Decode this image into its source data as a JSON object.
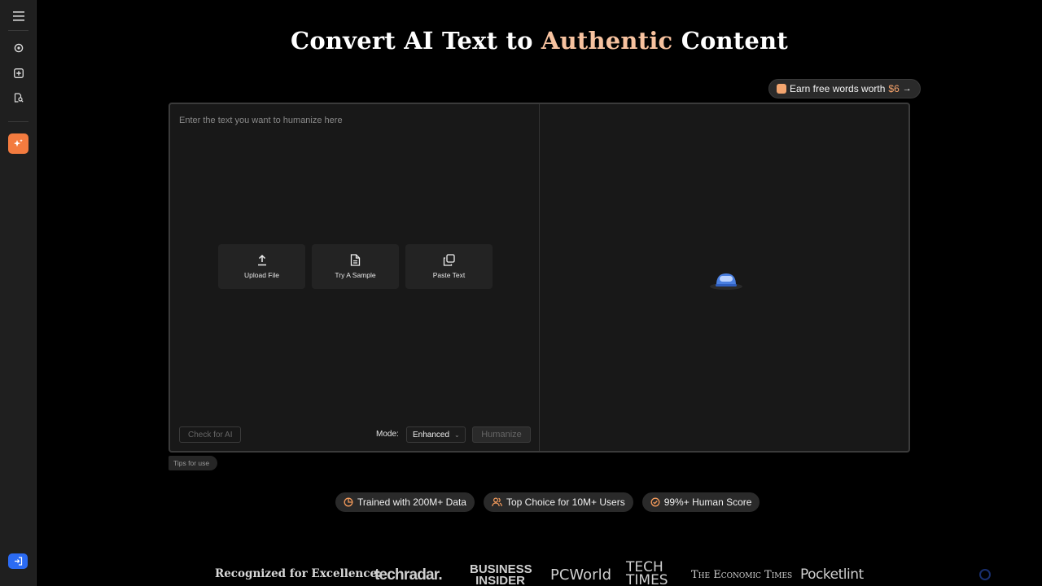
{
  "title": {
    "part1": "Convert AI Text to",
    "accent": "Authentic",
    "part2": "Content",
    "accent_color": "#f7c29f"
  },
  "earn": {
    "text": "Earn free words worth",
    "amount": "$6",
    "arrow": "→"
  },
  "sidebar": {
    "items": [
      {
        "icon": "menu-icon"
      },
      {
        "icon": "detector-icon"
      },
      {
        "icon": "add-icon"
      },
      {
        "icon": "document-search-icon"
      },
      {
        "icon": "humanizer-sparkle-icon",
        "active": true
      }
    ],
    "logout_icon": "logout-icon",
    "active_color": "#f37b3f",
    "logout_color": "#2b6bf3"
  },
  "editor": {
    "placeholder": "Enter the text you want to humanize here",
    "actions": [
      {
        "label": "Upload File",
        "icon": "upload-icon"
      },
      {
        "label": "Try A Sample",
        "icon": "document-icon"
      },
      {
        "label": "Paste Text",
        "icon": "copy-icon"
      }
    ],
    "check_label": "Check for AI",
    "mode_label": "Mode:",
    "mode_value": "Enhanced",
    "humanize_label": "Humanize"
  },
  "tips": "Tips for use",
  "badges": [
    {
      "text": "Trained with 200M+ Data",
      "icon": "data-icon"
    },
    {
      "text": "Top Choice for 10M+ Users",
      "icon": "users-icon"
    },
    {
      "text": "99%+ Human Score",
      "icon": "check-circle-icon"
    }
  ],
  "recognized": {
    "label": "Recognized for Excellence:",
    "logos": [
      "techradar.",
      "BUSINESS INSIDER",
      "PCWorld",
      "TECH TIMES",
      "The Economic Times",
      "Pocketlint"
    ]
  }
}
